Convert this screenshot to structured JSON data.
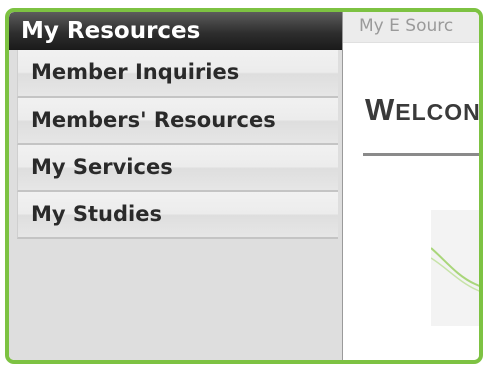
{
  "sidebar": {
    "title": "My Resources",
    "items": [
      {
        "label": "Member Inquiries"
      },
      {
        "label": "Members' Resources"
      },
      {
        "label": "My Services"
      },
      {
        "label": "My Studies"
      }
    ]
  },
  "content": {
    "tab_label": "My E Sourc",
    "heading_first": "W",
    "heading_rest": "ELCON"
  },
  "colors": {
    "frame_border": "#7dc242",
    "header_bg": "#2e2e2e",
    "graphic_stroke": "#a9d67a"
  }
}
